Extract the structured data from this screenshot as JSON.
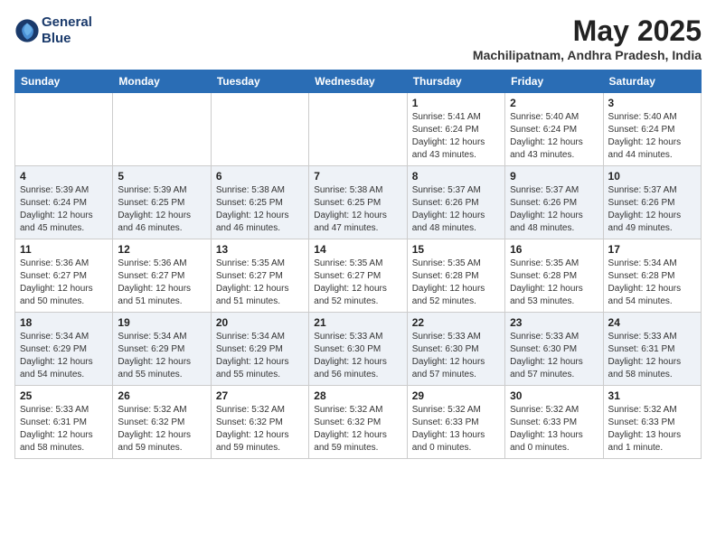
{
  "header": {
    "logo_line1": "General",
    "logo_line2": "Blue",
    "month_title": "May 2025",
    "location": "Machilipatnam, Andhra Pradesh, India"
  },
  "days_of_week": [
    "Sunday",
    "Monday",
    "Tuesday",
    "Wednesday",
    "Thursday",
    "Friday",
    "Saturday"
  ],
  "weeks": [
    [
      {
        "day": "",
        "info": ""
      },
      {
        "day": "",
        "info": ""
      },
      {
        "day": "",
        "info": ""
      },
      {
        "day": "",
        "info": ""
      },
      {
        "day": "1",
        "info": "Sunrise: 5:41 AM\nSunset: 6:24 PM\nDaylight: 12 hours\nand 43 minutes."
      },
      {
        "day": "2",
        "info": "Sunrise: 5:40 AM\nSunset: 6:24 PM\nDaylight: 12 hours\nand 43 minutes."
      },
      {
        "day": "3",
        "info": "Sunrise: 5:40 AM\nSunset: 6:24 PM\nDaylight: 12 hours\nand 44 minutes."
      }
    ],
    [
      {
        "day": "4",
        "info": "Sunrise: 5:39 AM\nSunset: 6:24 PM\nDaylight: 12 hours\nand 45 minutes."
      },
      {
        "day": "5",
        "info": "Sunrise: 5:39 AM\nSunset: 6:25 PM\nDaylight: 12 hours\nand 46 minutes."
      },
      {
        "day": "6",
        "info": "Sunrise: 5:38 AM\nSunset: 6:25 PM\nDaylight: 12 hours\nand 46 minutes."
      },
      {
        "day": "7",
        "info": "Sunrise: 5:38 AM\nSunset: 6:25 PM\nDaylight: 12 hours\nand 47 minutes."
      },
      {
        "day": "8",
        "info": "Sunrise: 5:37 AM\nSunset: 6:26 PM\nDaylight: 12 hours\nand 48 minutes."
      },
      {
        "day": "9",
        "info": "Sunrise: 5:37 AM\nSunset: 6:26 PM\nDaylight: 12 hours\nand 48 minutes."
      },
      {
        "day": "10",
        "info": "Sunrise: 5:37 AM\nSunset: 6:26 PM\nDaylight: 12 hours\nand 49 minutes."
      }
    ],
    [
      {
        "day": "11",
        "info": "Sunrise: 5:36 AM\nSunset: 6:27 PM\nDaylight: 12 hours\nand 50 minutes."
      },
      {
        "day": "12",
        "info": "Sunrise: 5:36 AM\nSunset: 6:27 PM\nDaylight: 12 hours\nand 51 minutes."
      },
      {
        "day": "13",
        "info": "Sunrise: 5:35 AM\nSunset: 6:27 PM\nDaylight: 12 hours\nand 51 minutes."
      },
      {
        "day": "14",
        "info": "Sunrise: 5:35 AM\nSunset: 6:27 PM\nDaylight: 12 hours\nand 52 minutes."
      },
      {
        "day": "15",
        "info": "Sunrise: 5:35 AM\nSunset: 6:28 PM\nDaylight: 12 hours\nand 52 minutes."
      },
      {
        "day": "16",
        "info": "Sunrise: 5:35 AM\nSunset: 6:28 PM\nDaylight: 12 hours\nand 53 minutes."
      },
      {
        "day": "17",
        "info": "Sunrise: 5:34 AM\nSunset: 6:28 PM\nDaylight: 12 hours\nand 54 minutes."
      }
    ],
    [
      {
        "day": "18",
        "info": "Sunrise: 5:34 AM\nSunset: 6:29 PM\nDaylight: 12 hours\nand 54 minutes."
      },
      {
        "day": "19",
        "info": "Sunrise: 5:34 AM\nSunset: 6:29 PM\nDaylight: 12 hours\nand 55 minutes."
      },
      {
        "day": "20",
        "info": "Sunrise: 5:34 AM\nSunset: 6:29 PM\nDaylight: 12 hours\nand 55 minutes."
      },
      {
        "day": "21",
        "info": "Sunrise: 5:33 AM\nSunset: 6:30 PM\nDaylight: 12 hours\nand 56 minutes."
      },
      {
        "day": "22",
        "info": "Sunrise: 5:33 AM\nSunset: 6:30 PM\nDaylight: 12 hours\nand 57 minutes."
      },
      {
        "day": "23",
        "info": "Sunrise: 5:33 AM\nSunset: 6:30 PM\nDaylight: 12 hours\nand 57 minutes."
      },
      {
        "day": "24",
        "info": "Sunrise: 5:33 AM\nSunset: 6:31 PM\nDaylight: 12 hours\nand 58 minutes."
      }
    ],
    [
      {
        "day": "25",
        "info": "Sunrise: 5:33 AM\nSunset: 6:31 PM\nDaylight: 12 hours\nand 58 minutes."
      },
      {
        "day": "26",
        "info": "Sunrise: 5:32 AM\nSunset: 6:32 PM\nDaylight: 12 hours\nand 59 minutes."
      },
      {
        "day": "27",
        "info": "Sunrise: 5:32 AM\nSunset: 6:32 PM\nDaylight: 12 hours\nand 59 minutes."
      },
      {
        "day": "28",
        "info": "Sunrise: 5:32 AM\nSunset: 6:32 PM\nDaylight: 12 hours\nand 59 minutes."
      },
      {
        "day": "29",
        "info": "Sunrise: 5:32 AM\nSunset: 6:33 PM\nDaylight: 13 hours\nand 0 minutes."
      },
      {
        "day": "30",
        "info": "Sunrise: 5:32 AM\nSunset: 6:33 PM\nDaylight: 13 hours\nand 0 minutes."
      },
      {
        "day": "31",
        "info": "Sunrise: 5:32 AM\nSunset: 6:33 PM\nDaylight: 13 hours\nand 1 minute."
      }
    ]
  ]
}
